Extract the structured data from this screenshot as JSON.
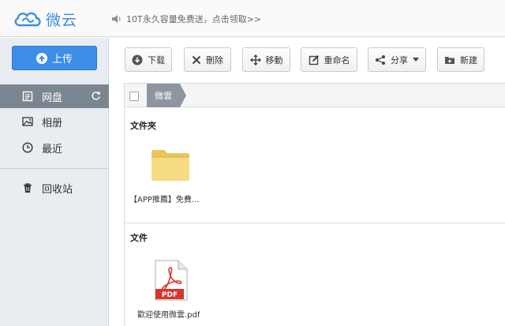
{
  "header": {
    "logo_text": "微云",
    "notice": "10T永久容量免费送，点击领取>>"
  },
  "sidebar": {
    "upload_label": "上传",
    "items": [
      {
        "label": "网盘",
        "icon": "disk-icon",
        "active": true
      },
      {
        "label": "相册",
        "icon": "photo-icon",
        "active": false
      },
      {
        "label": "最近",
        "icon": "clock-icon",
        "active": false
      },
      {
        "label": "回收站",
        "icon": "trash-icon",
        "active": false
      }
    ]
  },
  "toolbar": {
    "download": "下载",
    "delete": "刪除",
    "move": "移動",
    "rename": "重命名",
    "share": "分享",
    "new": "新建"
  },
  "breadcrumb": {
    "current": "微雲"
  },
  "sections": {
    "folders_title": "文件夾",
    "files_title": "文件"
  },
  "folders": [
    {
      "name": "【APP推薦】免費..."
    }
  ],
  "files": [
    {
      "name": "歡迎使用微雲.pdf",
      "type_label": "PDF"
    }
  ],
  "colors": {
    "accent": "#3c8ee6",
    "sidebar_bg": "#e9ecf0",
    "active_nav": "#7a8690",
    "pdf_red": "#d9342b"
  }
}
